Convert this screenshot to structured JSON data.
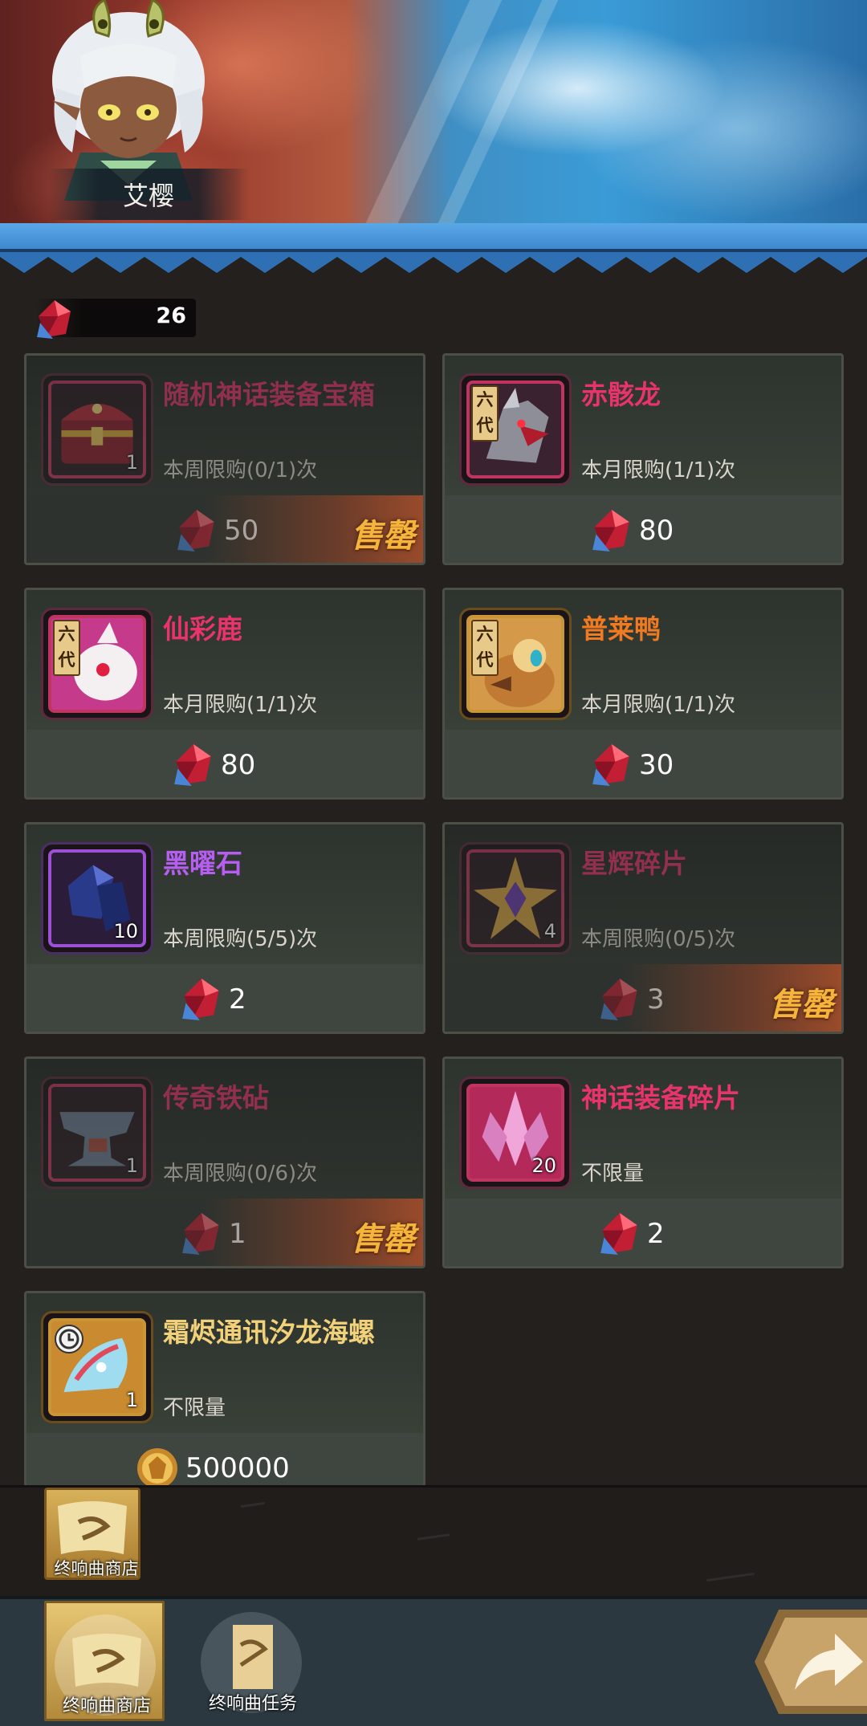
{
  "hero": {
    "name": "艾樱"
  },
  "currency": {
    "icon": "red-gem-icon",
    "amount": "26"
  },
  "shop_items": [
    {
      "name": "随机神话装备宝箱",
      "limit": "本周限购(0/1)次",
      "qty": "1",
      "price": "50",
      "price_icon": "red-gem-icon",
      "sold_out": true,
      "sold_out_label": "售罄"
    },
    {
      "name": "赤骸龙",
      "limit": "本月限购(1/1)次",
      "badge": "六代",
      "price": "80",
      "price_icon": "red-gem-icon",
      "sold_out": false
    },
    {
      "name": "仙彩鹿",
      "limit": "本月限购(1/1)次",
      "badge": "六代",
      "price": "80",
      "price_icon": "red-gem-icon",
      "sold_out": false
    },
    {
      "name": "普莱鸭",
      "limit": "本月限购(1/1)次",
      "badge": "六代",
      "price": "30",
      "price_icon": "red-gem-icon",
      "sold_out": false
    },
    {
      "name": "黑曜石",
      "limit": "本周限购(5/5)次",
      "qty": "10",
      "price": "2",
      "price_icon": "red-gem-icon",
      "sold_out": false
    },
    {
      "name": "星辉碎片",
      "limit": "本周限购(0/5)次",
      "qty": "4",
      "price": "3",
      "price_icon": "red-gem-icon",
      "sold_out": true,
      "sold_out_label": "售罄"
    },
    {
      "name": "传奇铁砧",
      "limit": "本周限购(0/6)次",
      "qty": "1",
      "price": "1",
      "price_icon": "red-gem-icon",
      "sold_out": true,
      "sold_out_label": "售罄"
    },
    {
      "name": "神话装备碎片",
      "limit": "不限量",
      "qty": "20",
      "price": "2",
      "price_icon": "red-gem-icon",
      "sold_out": false
    },
    {
      "name": "霜烬通讯汐龙海螺",
      "limit": "不限量",
      "qty": "1",
      "price": "500000",
      "price_icon": "gold-coin-icon",
      "sold_out": false
    }
  ],
  "floating_shop": {
    "label": "终响曲商店"
  },
  "tabs": [
    {
      "label": "终响曲商店",
      "active": true
    },
    {
      "label": "终响曲任务",
      "active": false
    }
  ],
  "colors": {
    "name_red": "#e8336c",
    "name_orange": "#f07a22",
    "name_purple": "#b65ef0",
    "name_gold": "#f1d179",
    "sold_out": "#f5b43a"
  }
}
